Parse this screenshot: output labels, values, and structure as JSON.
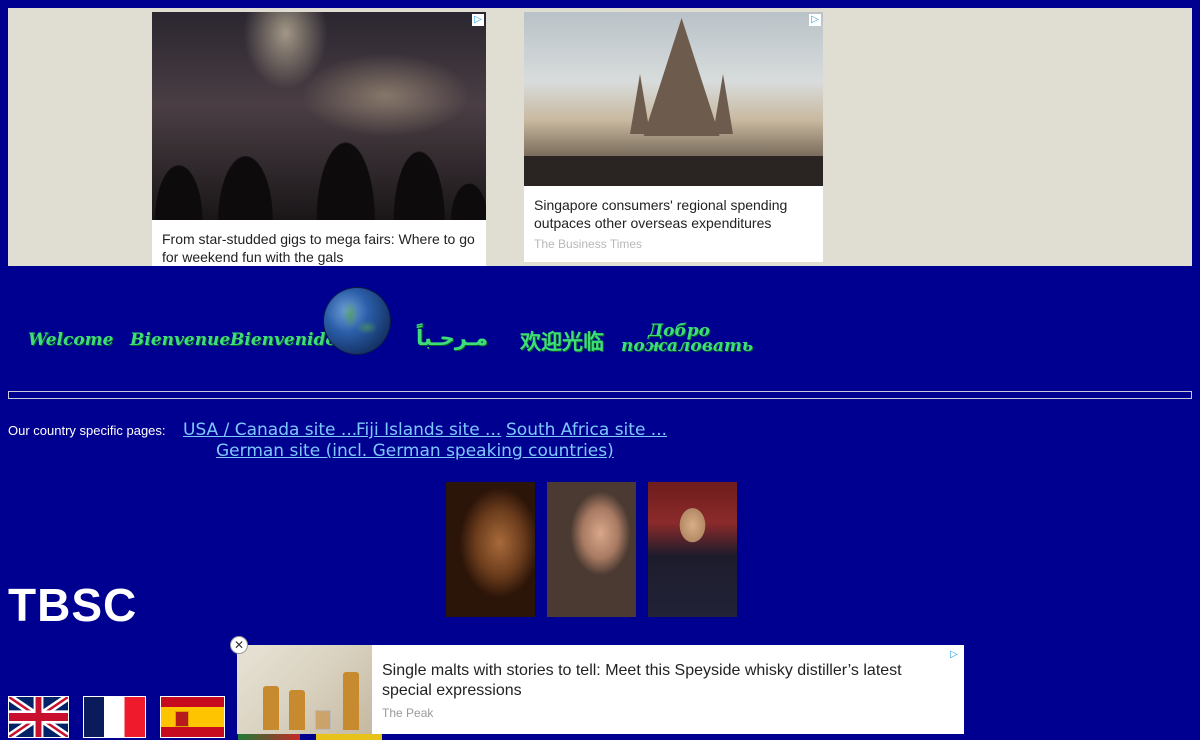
{
  "ads": {
    "top_left": {
      "caption": "From star-studded gigs to mega fairs: Where to go for weekend fun with the gals"
    },
    "top_right": {
      "caption": "Singapore consumers' regional spending outpaces other overseas expenditures",
      "source": "The Business Times"
    },
    "bottom": {
      "title": "Single malts with stories to tell: Meet this Speyside whisky distiller’s latest special expressions",
      "source": "The Peak",
      "close_label": "✕"
    },
    "adchoice_icon": "▷"
  },
  "greetings": {
    "english": "Welcome",
    "french": "Bienvenue",
    "spanish": "Bienvenido",
    "arabic": "مـرحـباً",
    "chinese": "欢迎光临",
    "russian_line1": "Добро",
    "russian_line2": "пожаловать"
  },
  "country_pages": {
    "label": "Our country specific pages:",
    "links": {
      "usa": "USA / Canada site ...",
      "fiji": "Fiji Islands site ...",
      "south_africa": "South Africa site ...",
      "german": "German site (incl. German speaking countries)"
    }
  },
  "brand": {
    "name": "TBSC"
  },
  "colors": {
    "background": "#000090",
    "greeting": "#3fdc7a",
    "link": "#7ec8ff"
  }
}
